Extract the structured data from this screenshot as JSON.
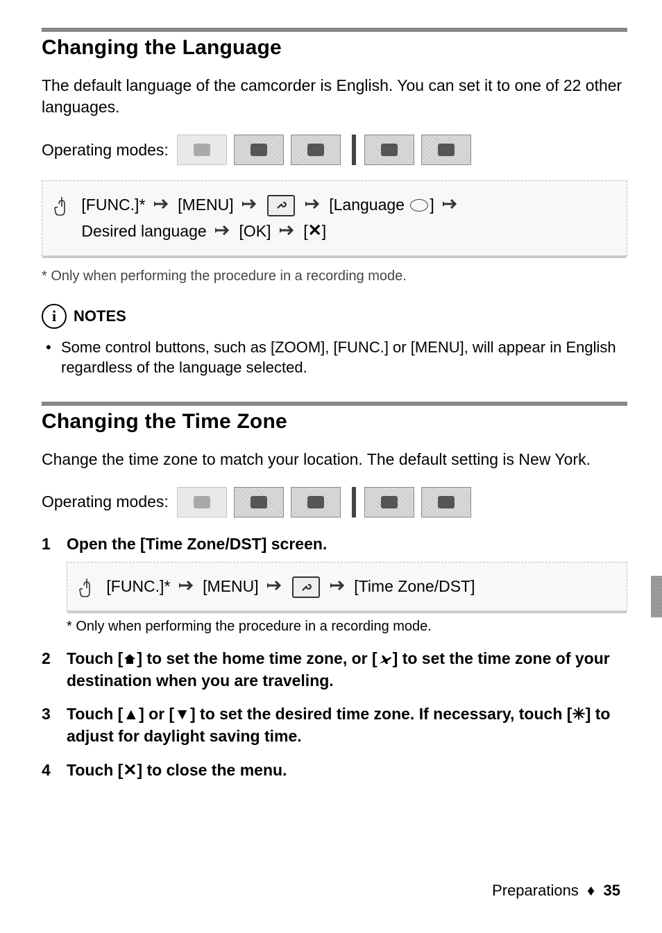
{
  "section1": {
    "title": "Changing the Language",
    "intro": "The default language of the camcorder is English. You can set it to one of 22 other languages.",
    "opModesLabel": "Operating modes:",
    "path": {
      "func": "[FUNC.]*",
      "menu": "[MENU]",
      "language": "[Language",
      "languageEnd": "]",
      "line2a": "Desired language",
      "ok": "[OK]",
      "close": "[",
      "closeEnd": "]"
    },
    "footnote": "* Only when performing the procedure in a recording mode.",
    "notesLabel": "NOTES",
    "note1": "Some control buttons, such as [ZOOM], [FUNC.] or [MENU], will appear in English regardless of the language selected."
  },
  "section2": {
    "title": "Changing the Time Zone",
    "intro": "Change the time zone to match your location. The default setting is New York.",
    "opModesLabel": "Operating modes:",
    "step1": {
      "title": "Open the [Time Zone/DST] screen.",
      "path": {
        "func": "[FUNC.]*",
        "menu": "[MENU]",
        "tz": "[Time Zone/DST]"
      },
      "footnote": "* Only when performing the procedure in a recording mode."
    },
    "step2": {
      "pre": "Touch [",
      "mid": "] to set the home time zone, or [",
      "post": "] to set the time zone of your destination when you are traveling."
    },
    "step3": {
      "pre": "Touch [",
      "mid1": "] or [",
      "mid2": "] to set the desired time zone. If necessary, touch [",
      "post": "] to adjust for daylight saving time."
    },
    "step4": {
      "pre": "Touch [",
      "post": "] to close the menu."
    }
  },
  "footer": {
    "section": "Preparations",
    "sep": "♦",
    "page": "35"
  }
}
